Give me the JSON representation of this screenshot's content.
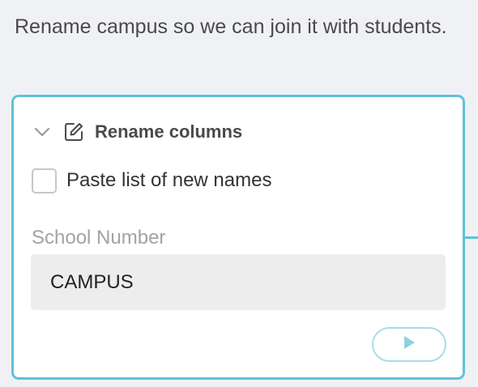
{
  "instruction": {
    "text": "Rename campus so we can join it with students."
  },
  "step": {
    "title": "Rename columns",
    "collapse_icon": "chevron-down-icon",
    "title_icon": "edit-icon",
    "paste_checkbox": {
      "label": "Paste list of new names",
      "checked": false
    },
    "field": {
      "label": "School Number",
      "value": "CAMPUS"
    },
    "run_icon": "play-icon"
  },
  "colors": {
    "accent": "#5cc3d9",
    "button_border": "#a9dce7",
    "play_fill": "#8fd0e0",
    "background": "#f0f1f5"
  }
}
